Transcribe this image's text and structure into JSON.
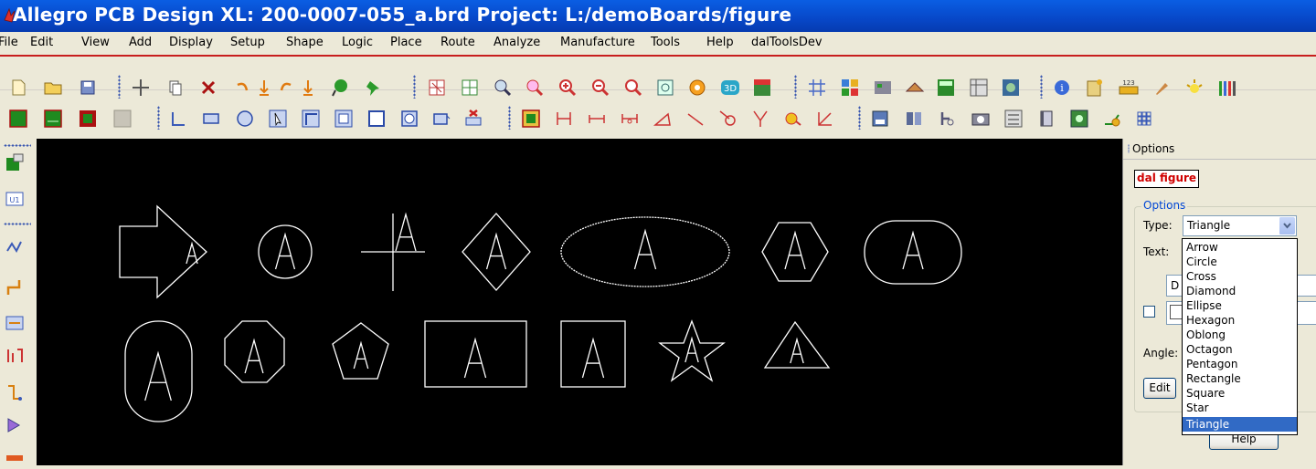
{
  "window": {
    "title": "Allegro PCB Design XL: 200-0007-055_a.brd  Project: L:/demoBoards/figure"
  },
  "menu": [
    "File",
    "Edit",
    "View",
    "Add",
    "Display",
    "Setup",
    "Shape",
    "Logic",
    "Place",
    "Route",
    "Analyze",
    "Manufacture",
    "Tools",
    "Help",
    "dalToolsDev"
  ],
  "toolbar_icons": {
    "row1": [
      "new-file",
      "open-folder",
      "save",
      "move",
      "copy",
      "delete",
      "undo",
      "step-down",
      "redo",
      "step-down",
      "highlight-pin",
      "pushpin",
      "grid-view",
      "grid-toggle",
      "zoom-fit",
      "zoom-points",
      "zoom-in",
      "zoom-out",
      "zoom-previous",
      "zoom-world",
      "refresh",
      "3d-view",
      "flip-design",
      "grid",
      "color",
      "layer",
      "shape",
      "ecm",
      "dfa",
      "board",
      "info",
      "property",
      "measure",
      "brush",
      "highlight",
      "stats"
    ],
    "row2": [
      "green-board",
      "board-outline",
      "route-keepout",
      "blank",
      "outline-line",
      "rectangle",
      "circle",
      "select",
      "shape-frame",
      "frame",
      "square",
      "rounded-square",
      "rect-small",
      "delete-shape",
      "component",
      "dimension-linear",
      "dimension-horizontal",
      "dimension-datum",
      "angle",
      "diagonal",
      "radius",
      "chamfer",
      "leader",
      "angular",
      "odb",
      "lib",
      "func",
      "camera",
      "refdes",
      "bookmark",
      "grid-snap",
      "pin",
      "matrix"
    ],
    "left": [
      "placement-icon",
      "refdes-icon",
      "route-icon",
      "connect-icon",
      "add-connect-icon",
      "bus-icon",
      "fanout-icon",
      "arrow-icon",
      "ruler-icon"
    ]
  },
  "canvas": {
    "label": "A",
    "figures": [
      "Arrow",
      "Circle",
      "Cross",
      "Diamond",
      "Ellipse",
      "Hexagon",
      "Oblong",
      "Oblong",
      "Octagon",
      "Pentagon",
      "Rectangle",
      "Square",
      "Star",
      "Triangle"
    ]
  },
  "panel": {
    "title": "Options",
    "figure_name": "dal figure",
    "group_title": "Options",
    "type_label": "Type:",
    "type_value": "Triangle",
    "text_label": "Text:",
    "text_value": "D",
    "angle_label": "Angle:",
    "edit_button": "Edit",
    "help_button": "Help"
  },
  "dropdown": {
    "options": [
      "Arrow",
      "Circle",
      "Cross",
      "Diamond",
      "Ellipse",
      "Hexagon",
      "Oblong",
      "Octagon",
      "Pentagon",
      "Rectangle",
      "Square",
      "Star",
      "Triangle"
    ],
    "selected": "Triangle"
  },
  "colors": {
    "accent": "#0a5ee3",
    "canvas": "#000000",
    "highlight": "#316ac5",
    "figure_name": "#d00000"
  }
}
